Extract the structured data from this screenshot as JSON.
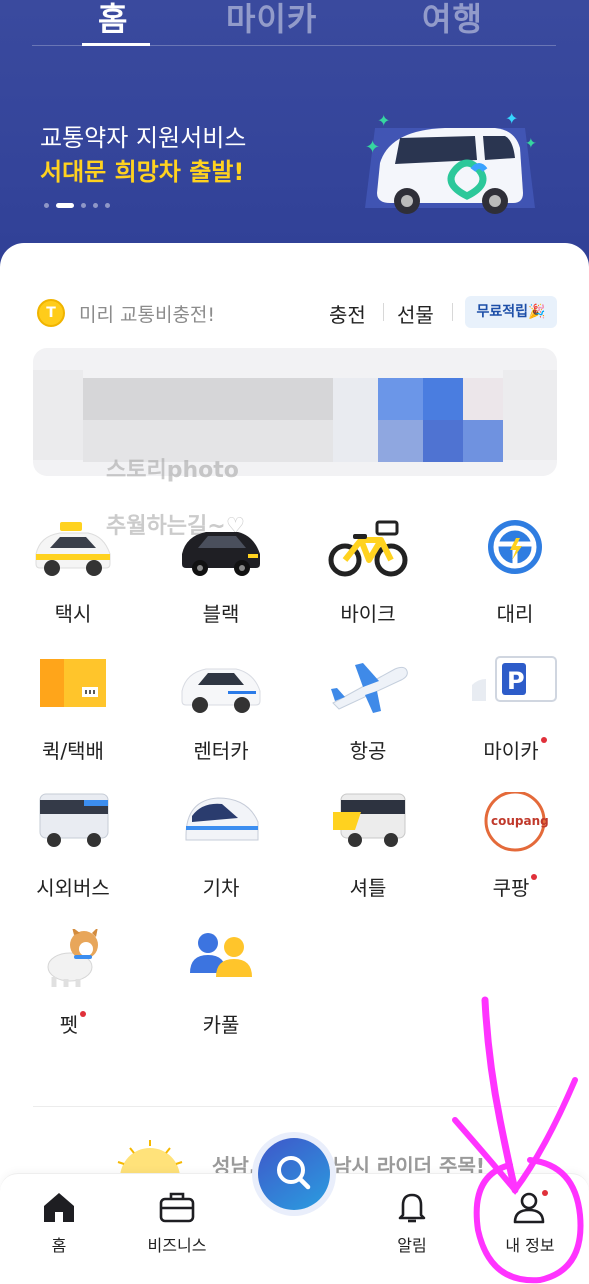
{
  "header": {
    "tabs": [
      {
        "label": "홈",
        "active": true
      },
      {
        "label": "마이카",
        "active": false
      },
      {
        "label": "여행",
        "active": false
      }
    ],
    "banner": {
      "line1": "교통약자 지원서비스",
      "line2": "서대문 희망차 출발!",
      "page_count": 5,
      "current_page": 2
    }
  },
  "charge": {
    "coin_symbol": "T",
    "text": "미리 교통비충전!",
    "charge_label": "충전",
    "gift_label": "선물",
    "free_badge": "무료적립🎉"
  },
  "watermark": {
    "line1": "스토리photo",
    "line2": "추월하는길~♡"
  },
  "services": [
    {
      "label": "택시",
      "icon": "taxi-icon",
      "new": false
    },
    {
      "label": "블랙",
      "icon": "black-car-icon",
      "new": false
    },
    {
      "label": "바이크",
      "icon": "bike-icon",
      "new": false
    },
    {
      "label": "대리",
      "icon": "steering-wheel-icon",
      "new": false
    },
    {
      "label": "퀵/택배",
      "icon": "parcel-box-icon",
      "new": false
    },
    {
      "label": "렌터카",
      "icon": "rental-car-icon",
      "new": false
    },
    {
      "label": "항공",
      "icon": "airplane-icon",
      "new": false
    },
    {
      "label": "마이카",
      "icon": "parking-icon",
      "new": true
    },
    {
      "label": "시외버스",
      "icon": "bus-icon",
      "new": false
    },
    {
      "label": "기차",
      "icon": "train-icon",
      "new": false
    },
    {
      "label": "셔틀",
      "icon": "shuttle-icon",
      "new": false
    },
    {
      "label": "쿠팡",
      "icon": "coupang-icon",
      "new": true
    },
    {
      "label": "펫",
      "icon": "pet-icon",
      "new": true
    },
    {
      "label": "카풀",
      "icon": "carpool-icon",
      "new": false
    }
  ],
  "coupang_logo_text": "coupang",
  "promo": {
    "text": "성남, 안산, 하남시 라이더 주목!"
  },
  "bottom_nav": [
    {
      "label": "홈",
      "icon": "home-icon",
      "active": true
    },
    {
      "label": "비즈니스",
      "icon": "briefcase-icon",
      "active": false
    },
    {
      "label": "",
      "icon": "search-icon",
      "active": false
    },
    {
      "label": "알림",
      "icon": "bell-icon",
      "active": false
    },
    {
      "label": "내 정보",
      "icon": "user-icon",
      "active": false,
      "badge": true
    }
  ],
  "colors": {
    "header_blue": "#34449a",
    "highlight_yellow": "#ffd21f",
    "badge_red": "#e0303a",
    "annotation_magenta": "#ff33ff"
  }
}
